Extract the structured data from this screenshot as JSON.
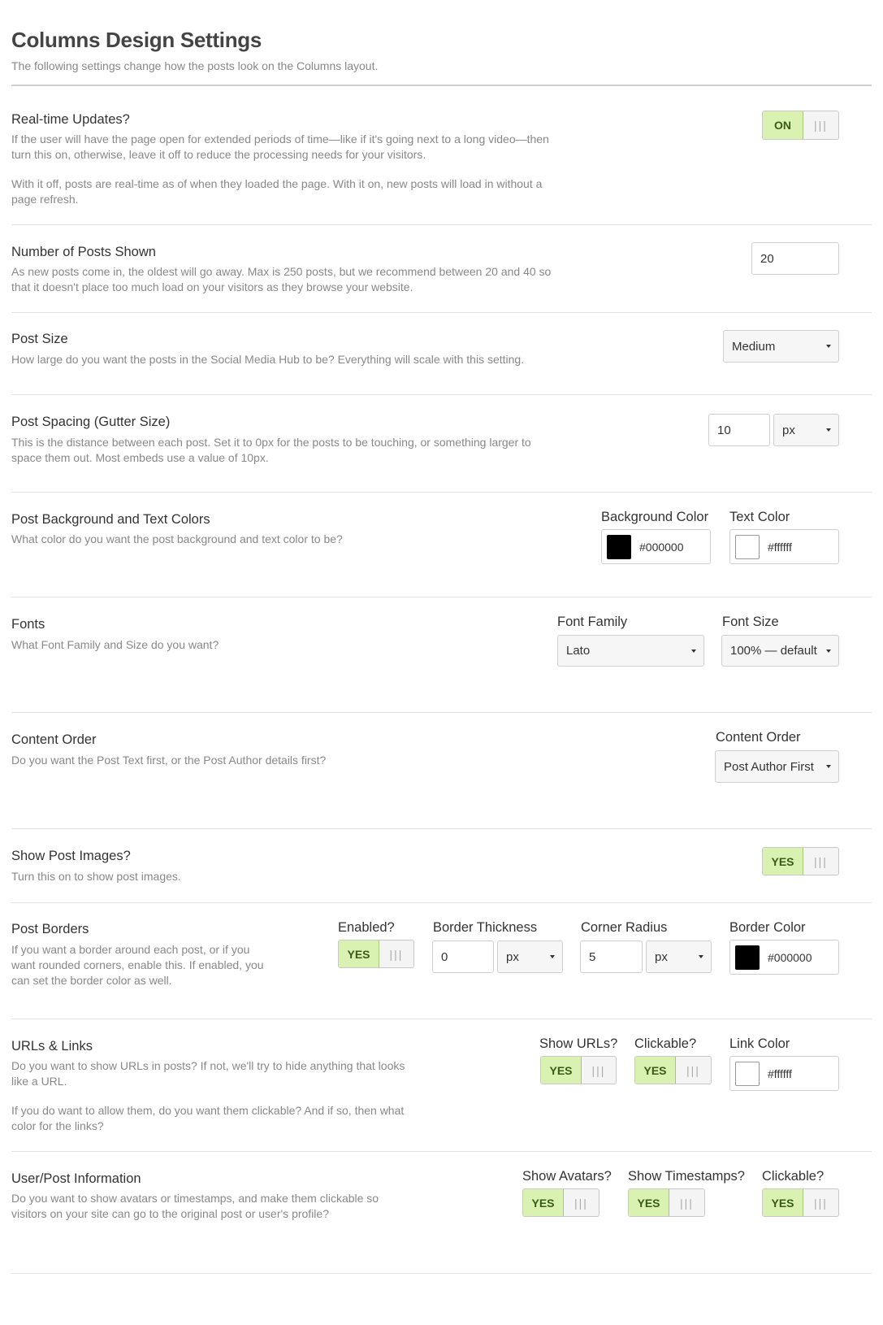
{
  "header": {
    "title": "Columns Design Settings",
    "subtitle": "The following settings change how the posts look on the Columns layout."
  },
  "realtime": {
    "title": "Real-time Updates?",
    "desc1": "If the user will have the page open for extended periods of time—like if it's going next to a long video—then turn this on, otherwise, leave it off to reduce the processing needs for your visitors.",
    "desc2": "With it off, posts are real-time as of when they loaded the page. With it on, new posts will load in without a page refresh.",
    "toggle": "ON"
  },
  "num_posts": {
    "title": "Number of Posts Shown",
    "desc": "As new posts come in, the oldest will go away. Max is 250 posts, but we recommend between 20 and 40 so that it doesn't place too much load on your visitors as they browse your website.",
    "value": "20"
  },
  "post_size": {
    "title": "Post Size",
    "desc": "How large do you want the posts in the Social Media Hub to be? Everything will scale with this setting.",
    "value": "Medium"
  },
  "spacing": {
    "title": "Post Spacing (Gutter Size)",
    "desc": "This is the distance between each post. Set it to 0px for the posts to be touching, or something larger to space them out. Most embeds use a value of 10px.",
    "value": "10",
    "unit": "px"
  },
  "colors": {
    "title": "Post Background and Text Colors",
    "desc": "What color do you want the post background and text color to be?",
    "bg_label": "Background Color",
    "bg_value": "#000000",
    "text_label": "Text Color",
    "text_value": "#ffffff"
  },
  "fonts": {
    "title": "Fonts",
    "desc": "What Font Family and Size do you want?",
    "family_label": "Font Family",
    "family_value": "Lato",
    "size_label": "Font Size",
    "size_value": "100% — default"
  },
  "content_order": {
    "title": "Content Order",
    "desc": "Do you want the Post Text first, or the Post Author details first?",
    "label": "Content Order",
    "value": "Post Author First"
  },
  "images": {
    "title": "Show Post Images?",
    "desc": "Turn this on to show post images.",
    "toggle": "YES"
  },
  "borders": {
    "title": "Post Borders",
    "desc": "If you want a border around each post, or if you want rounded corners, enable this. If enabled, you can set the border color as well.",
    "enabled_label": "Enabled?",
    "enabled_toggle": "YES",
    "thickness_label": "Border Thickness",
    "thickness_value": "0",
    "thickness_unit": "px",
    "radius_label": "Corner Radius",
    "radius_value": "5",
    "radius_unit": "px",
    "color_label": "Border Color",
    "color_value": "#000000"
  },
  "urls": {
    "title": "URLs & Links",
    "desc1": "Do you want to show URLs in posts? If not, we'll try to hide anything that looks like a URL.",
    "desc2": "If you do want to allow them, do you want them clickable? And if so, then what color for the links?",
    "show_label": "Show URLs?",
    "show_toggle": "YES",
    "clickable_label": "Clickable?",
    "clickable_toggle": "YES",
    "color_label": "Link Color",
    "color_value": "#ffffff"
  },
  "userinfo": {
    "title": "User/Post Information",
    "desc": "Do you want to show avatars or timestamps, and make them clickable so visitors on your site can go to the original post or user's profile?",
    "avatars_label": "Show Avatars?",
    "avatars_toggle": "YES",
    "timestamps_label": "Show Timestamps?",
    "timestamps_toggle": "YES",
    "clickable_label": "Clickable?",
    "clickable_toggle": "YES"
  },
  "icons": {
    "toggle_handle": "grip-lines-icon",
    "select_caret": "caret-down-icon"
  }
}
